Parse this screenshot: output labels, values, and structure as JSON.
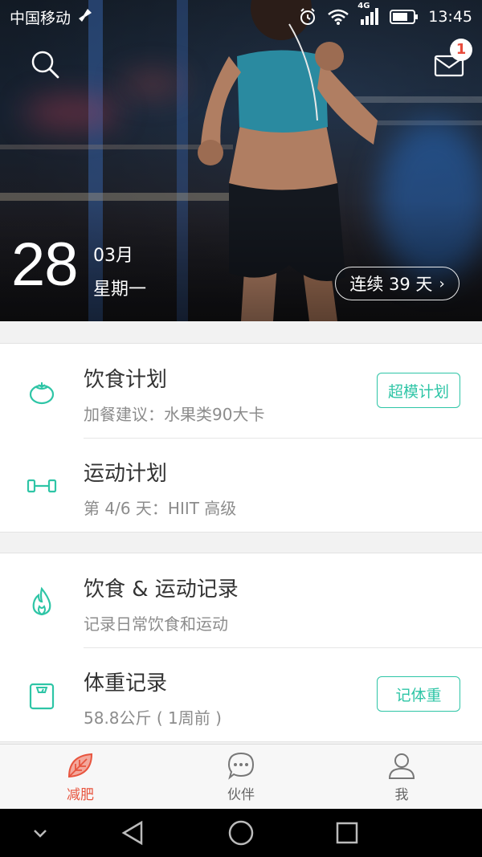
{
  "status_bar": {
    "carrier": "中国移动",
    "network": "4G",
    "time": "13:45"
  },
  "header": {
    "notification_count": "1"
  },
  "date": {
    "day": "28",
    "month": "03月",
    "weekday": "星期一"
  },
  "streak": {
    "label": "连续 39 天"
  },
  "plans": [
    {
      "title": "饮食计划",
      "subtitle": "加餐建议：水果类90大卡",
      "action": "超模计划",
      "icon": "tomato-icon"
    },
    {
      "title": "运动计划",
      "subtitle": "第 4/6 天：HIIT 高级",
      "icon": "dumbbell-icon"
    }
  ],
  "records": [
    {
      "title": "饮食 & 运动记录",
      "subtitle": "记录日常饮食和运动",
      "icon": "flame-icon"
    },
    {
      "title": "体重记录",
      "subtitle": "58.8公斤 ( 1周前 )",
      "action": "记体重",
      "icon": "scale-icon"
    }
  ],
  "tabs": [
    {
      "label": "减肥",
      "icon": "leaf-icon",
      "active": true
    },
    {
      "label": "伙伴",
      "icon": "chat-bubble-icon",
      "active": false
    },
    {
      "label": "我",
      "icon": "person-icon",
      "active": false
    }
  ],
  "colors": {
    "accent": "#2ec5a6",
    "active_tab": "#e8553f",
    "badge_text": "#e84c3d"
  }
}
